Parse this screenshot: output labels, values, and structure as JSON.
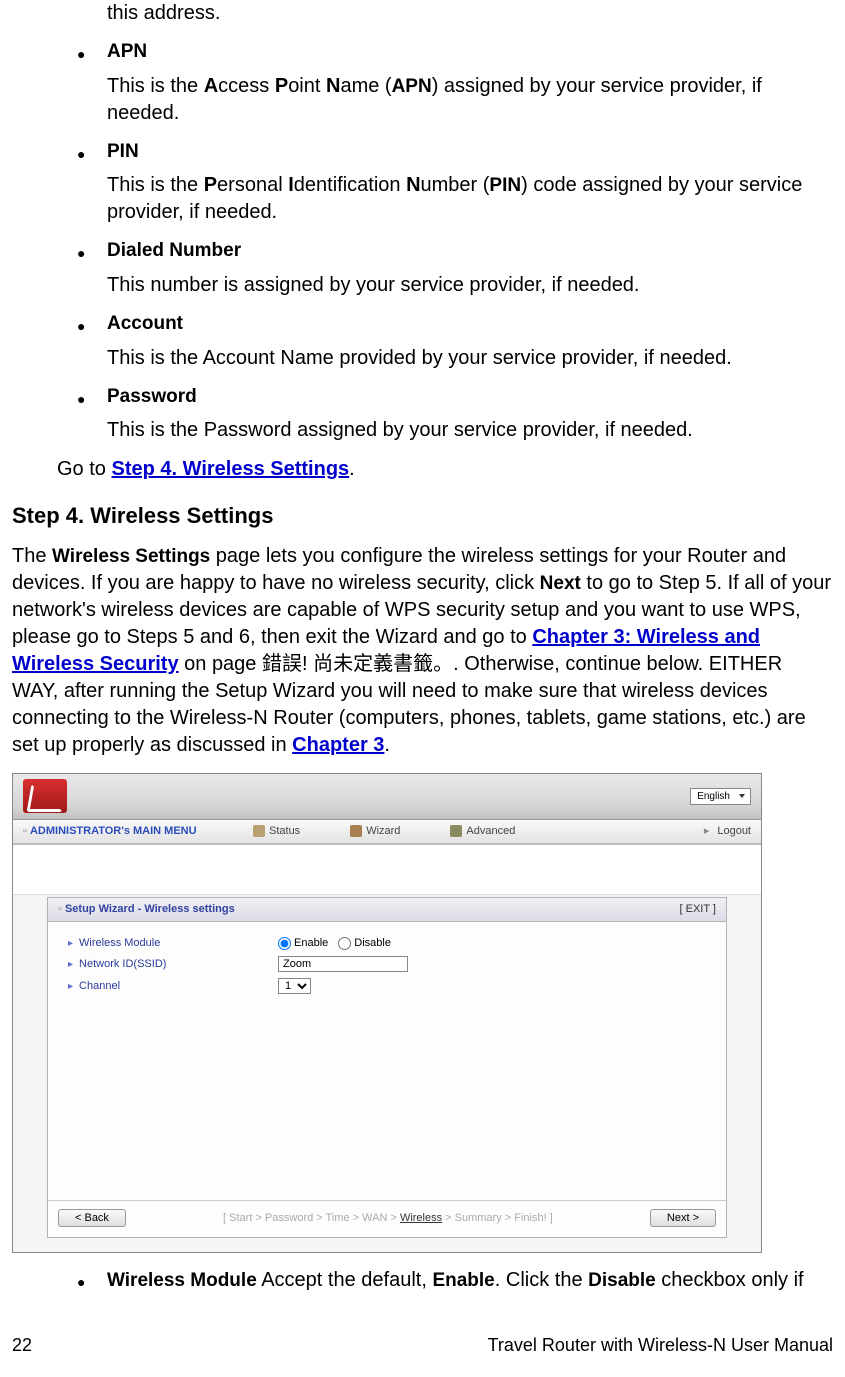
{
  "intro_prev_desc": "this address.",
  "items": {
    "apn": {
      "title": "APN",
      "desc_parts": [
        "This is the ",
        "A",
        "ccess ",
        "P",
        "oint ",
        "N",
        "ame (",
        "APN",
        ") assigned by your service provider, if needed."
      ]
    },
    "pin": {
      "title": "PIN",
      "desc_parts": [
        "This is the ",
        "P",
        "ersonal ",
        "I",
        "dentification ",
        "N",
        "umber (",
        "PIN",
        ") code assigned by your service provider, if needed."
      ]
    },
    "dialed": {
      "title": "Dialed Number",
      "desc": "This number is assigned by your service provider, if needed."
    },
    "account": {
      "title": "Account",
      "desc": "This is the Account Name provided by your service provider, if needed."
    },
    "password": {
      "title": "Password",
      "desc": "This is the Password assigned by your service provider, if needed."
    }
  },
  "goto": {
    "prefix": "Go to ",
    "link": "Step 4. Wireless Settings",
    "suffix": "."
  },
  "step4": {
    "heading": "Step 4. Wireless Settings",
    "para": {
      "p1": "The ",
      "bws": "Wireless Settings",
      "p2": " page lets you configure the wireless settings for your Router and devices. If you are happy to have no wireless security, click ",
      "bnext": "Next",
      "p3": " to go to Step 5. If all of your network's wireless devices are capable of WPS security setup and you want to use WPS, please go to Steps 5 and 6, then exit the Wizard and go to ",
      "link1": "Chapter 3: Wireless and Wireless Security",
      "p4": " on page  錯誤!  尚未定義書籤。. Otherwise, continue below. EITHER WAY, after running the Setup Wizard you will need to make sure that wireless devices connecting to the Wireless-N Router (computers, phones, tablets, game stations, etc.) are set up properly as discussed in ",
      "link2": "Chapter 3",
      "p5": "."
    }
  },
  "screenshot": {
    "language": "English",
    "mainmenu_title": "ADMINISTRATOR's MAIN MENU",
    "menu": {
      "status": "Status",
      "wizard": "Wizard",
      "advanced": "Advanced",
      "logout": "Logout"
    },
    "panel_title": "Setup Wizard - Wireless settings",
    "exit": "[ EXIT ]",
    "rows": {
      "wireless_module": "Wireless Module",
      "enable": "Enable",
      "disable": "Disable",
      "network_id": "Network ID(SSID)",
      "ssid_value": "Zoom",
      "channel": "Channel",
      "channel_value": "1"
    },
    "back_btn": "< Back",
    "next_btn": "Next >",
    "crumb": {
      "a": "[ Start > Password > Time > WAN > ",
      "cur": "Wireless",
      "b": " > Summary > Finish! ]"
    }
  },
  "post_item": {
    "bold1": "Wireless Module",
    "mid1": " Accept the default, ",
    "bold2": "Enable",
    "mid2": ". Click the ",
    "bold3": "Disable",
    "mid3": " checkbox only if"
  },
  "footer": {
    "page": "22",
    "manual": "Travel Router with Wireless-N User Manual"
  }
}
